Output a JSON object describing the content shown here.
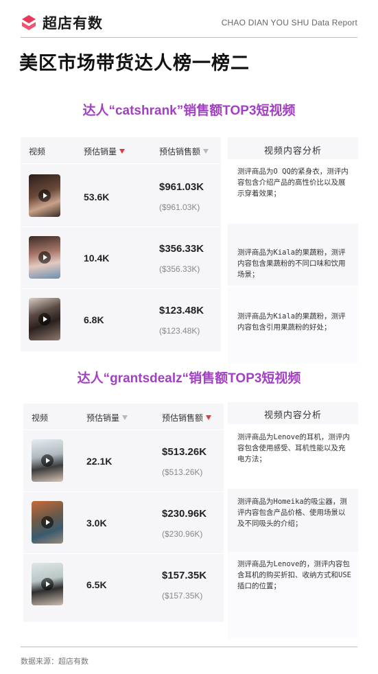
{
  "header": {
    "brand_name": "超店有数",
    "brand_color": "#e8395a",
    "report_tag": "CHAO DIAN YOU SHU Data Report"
  },
  "page_title": "美区市场带货达人榜一榜二",
  "sections": [
    {
      "title": "达人“catshrank”销售额TOP3短视频",
      "columns": {
        "video": "视频",
        "volume": "预估销量",
        "sales": "预估销售额",
        "analysis": "视频内容分析"
      },
      "sort_indicators": {
        "volume": "red",
        "sales": "gray"
      },
      "rows": [
        {
          "volume": "53.6K",
          "sales": "$961.03K",
          "sales_sub": "($961.03K)",
          "analysis": "测评商品为O QQ的紧身衣，测评内容包含介绍产品的高性价比以及展示穿着效果；"
        },
        {
          "volume": "10.4K",
          "sales": "$356.33K",
          "sales_sub": "($356.33K)",
          "analysis": "测评商品为Kiala的果蔬粉，测评内容包含果蔬粉的不同口味和饮用场景；"
        },
        {
          "volume": "6.8K",
          "sales": "$123.48K",
          "sales_sub": "($123.48K)",
          "analysis": "测评商品为Kiala的果蔬粉，测评内容包含引用果蔬粉的好处；"
        }
      ]
    },
    {
      "title": "达人“grantsdealz“销售额TOP3短视频",
      "columns": {
        "video": "视频",
        "volume": "预估销量",
        "sales": "预估销售额",
        "analysis": "视频内容分析"
      },
      "sort_indicators": {
        "volume": "gray",
        "sales": "red"
      },
      "rows": [
        {
          "volume": "22.1K",
          "sales": "$513.26K",
          "sales_sub": "($513.26K)",
          "analysis": "测评商品为Lenove的耳机，测评内容包含使用感受、耳机性能以及充电方法；"
        },
        {
          "volume": "3.0K",
          "sales": "$230.96K",
          "sales_sub": "($230.96K)",
          "analysis": "测评商品为Homeika的吸尘器，测评内容包含产品价格、使用场景以及不同吸头的介绍；"
        },
        {
          "volume": "6.5K",
          "sales": "$157.35K",
          "sales_sub": "($157.35K)",
          "analysis": "测评商品为Lenove的，测评内容包含耳机的购买折扣、收纳方式和USE插口的位置；"
        }
      ]
    }
  ],
  "footer": {
    "source": "数据来源：超店有数"
  }
}
